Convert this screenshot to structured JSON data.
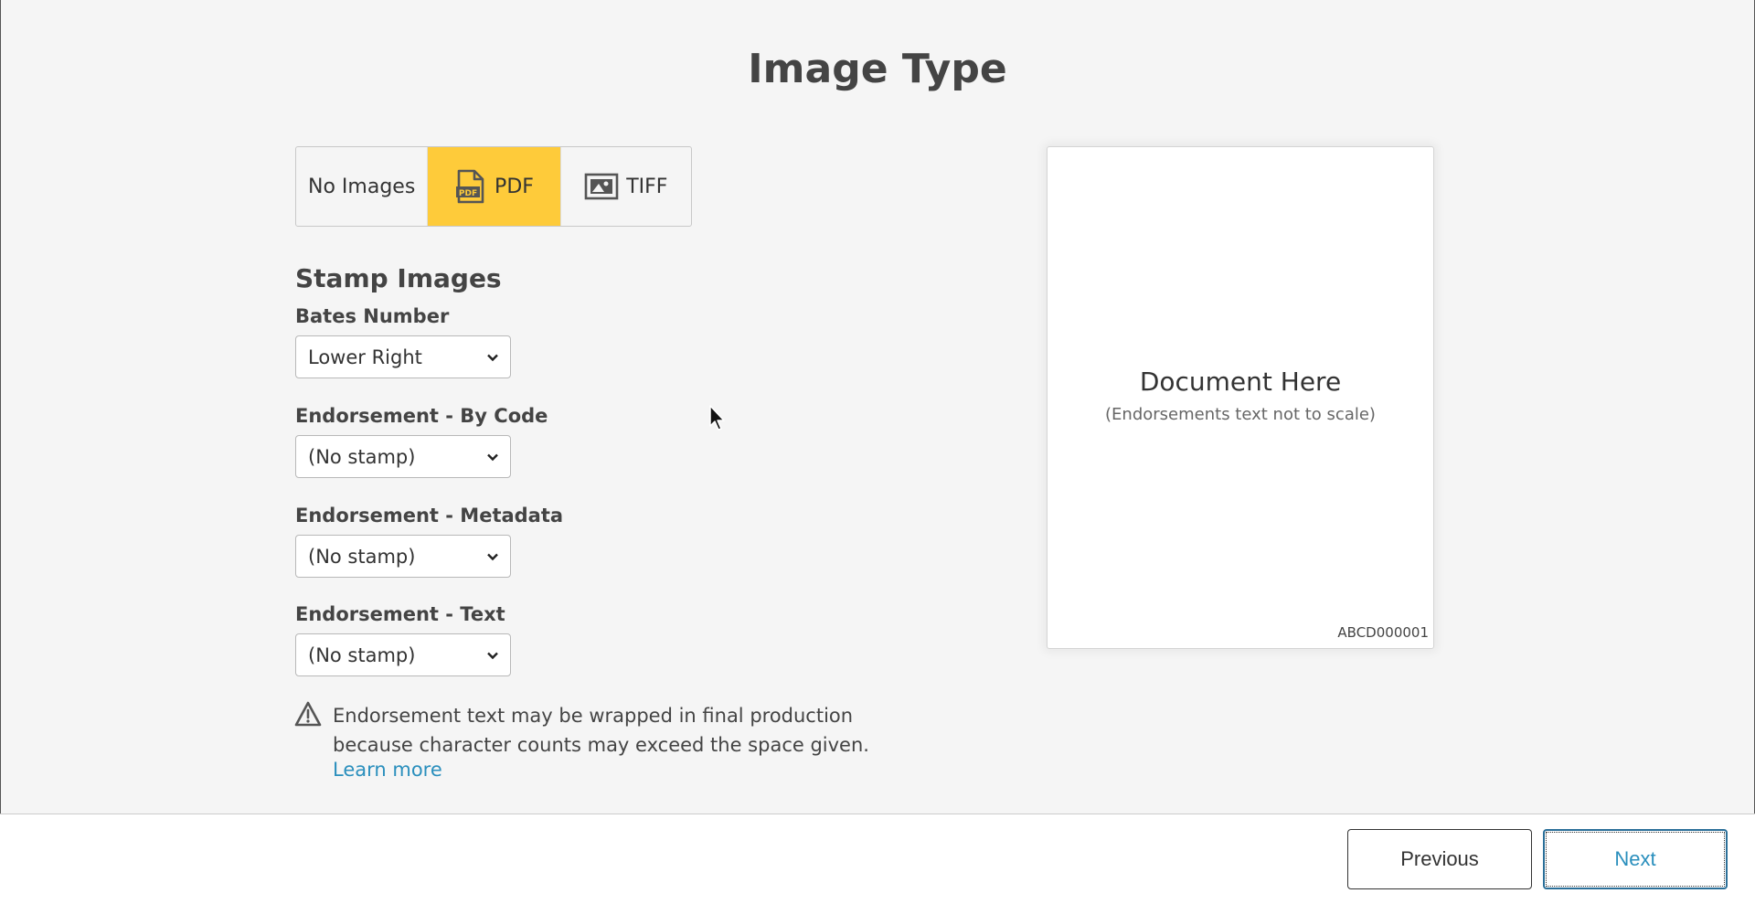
{
  "page": {
    "title": "Image Type"
  },
  "image_type": {
    "options": [
      {
        "label": "No Images",
        "icon": ""
      },
      {
        "label": "PDF",
        "icon": "pdf-file-icon"
      },
      {
        "label": "TIFF",
        "icon": "image-icon"
      }
    ],
    "selected": "PDF",
    "selected_color": "#fecb3a"
  },
  "stamp": {
    "title": "Stamp Images",
    "fields": [
      {
        "label": "Bates Number",
        "value": "Lower Right"
      },
      {
        "label": "Endorsement - By Code",
        "value": "(No stamp)"
      },
      {
        "label": "Endorsement - Metadata",
        "value": "(No stamp)"
      },
      {
        "label": "Endorsement - Text",
        "value": "(No stamp)"
      }
    ]
  },
  "warning": {
    "icon": "warning-icon",
    "text": "Endorsement text may be wrapped in final production because character counts may exceed the space given.",
    "link": "Learn more",
    "link_color": "#2a8fbd"
  },
  "preview": {
    "heading": "Document Here",
    "subheading": "(Endorsements text not to scale)",
    "bates_number": "ABCD000001"
  },
  "footer": {
    "previous_label": "Previous",
    "next_label": "Next"
  }
}
